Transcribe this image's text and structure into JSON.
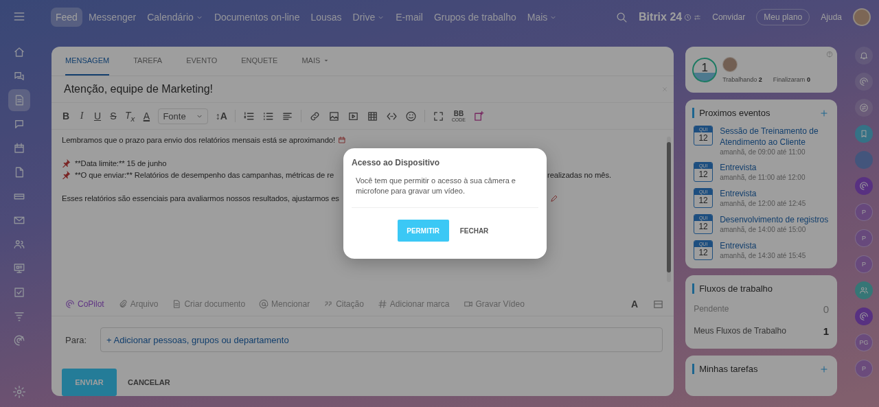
{
  "sidebar": {
    "items": [
      {
        "selected": false
      },
      {
        "selected": false
      },
      {
        "selected": true
      },
      {
        "selected": false
      },
      {
        "selected": false
      },
      {
        "selected": false
      },
      {
        "selected": false
      },
      {
        "selected": false
      },
      {
        "selected": false
      },
      {
        "selected": false
      },
      {
        "selected": false
      },
      {
        "selected": false
      },
      {
        "selected": false
      }
    ]
  },
  "topbar": {
    "nav": [
      {
        "label": "Feed",
        "selected": true,
        "dropdown": false
      },
      {
        "label": "Messenger",
        "selected": false,
        "dropdown": false
      },
      {
        "label": "Calendário",
        "selected": false,
        "dropdown": true
      },
      {
        "label": "Documentos on-line",
        "selected": false,
        "dropdown": false
      },
      {
        "label": "Lousas",
        "selected": false,
        "dropdown": false
      },
      {
        "label": "Drive",
        "selected": false,
        "dropdown": true
      },
      {
        "label": "E-mail",
        "selected": false,
        "dropdown": false
      },
      {
        "label": "Grupos de trabalho",
        "selected": false,
        "dropdown": false
      },
      {
        "label": "Mais",
        "selected": false,
        "dropdown": true
      }
    ],
    "logo": {
      "name": "Bitrix",
      "number": "24"
    },
    "invite": "Convidar",
    "plan": "Meu plano",
    "help": "Ajuda"
  },
  "editor": {
    "tabs": [
      {
        "label": "MENSAGEM",
        "selected": true,
        "dropdown": false
      },
      {
        "label": "TAREFA",
        "selected": false,
        "dropdown": false
      },
      {
        "label": "EVENTO",
        "selected": false,
        "dropdown": false
      },
      {
        "label": "ENQUETE",
        "selected": false,
        "dropdown": false
      },
      {
        "label": "MAIS",
        "selected": false,
        "dropdown": true
      }
    ],
    "title": "Atenção, equipe de Marketing!",
    "format": [
      {
        "kind": "bold",
        "text": "B"
      },
      {
        "kind": "italic",
        "text": "I"
      },
      {
        "kind": "underline",
        "text": "U"
      },
      {
        "kind": "strike",
        "text": "S"
      },
      {
        "kind": "clear",
        "text": "T$_{x}$"
      },
      {
        "kind": "color",
        "text": "A"
      }
    ],
    "font": "Fonte",
    "size": "↕A",
    "bbcode": [
      "BB",
      "CODE"
    ],
    "lines": [
      {
        "kind": "text",
        "text": "Lembramos que o prazo para envio dos relatórios mensais está se aproximando!",
        "emoji": true
      },
      {
        "kind": "blank"
      },
      {
        "kind": "pin",
        "text": "**Data limite:** 15 de junho"
      },
      {
        "kind": "pin",
        "text": "**O que enviar:** Relatórios de desempenho das campanhas, métricas de re",
        "tail": "realizadas no mês."
      },
      {
        "kind": "blank"
      },
      {
        "kind": "text",
        "text": "Esses relatórios são essenciais para avaliarmos nossos resultados, ajustarmos es",
        "tail_emoji": true
      }
    ],
    "actions": [
      {
        "kind": "copilot",
        "label": "CoPilot"
      },
      {
        "kind": "file",
        "label": "Arquivo"
      },
      {
        "kind": "doc",
        "label": "Criar documento"
      },
      {
        "kind": "mention",
        "label": "Mencionar"
      },
      {
        "kind": "quote",
        "label": "Citação"
      },
      {
        "kind": "tag",
        "label": "Adicionar marca"
      },
      {
        "kind": "video",
        "label": "Gravar Vídeo"
      }
    ],
    "text_style": "A",
    "to_label": "Para:",
    "to_add": "+ Adicionar pessoas, grupos ou departamento",
    "send": "ENVIAR",
    "cancel": "CANCELAR"
  },
  "status": {
    "count": "1",
    "working_label": "Trabalhando",
    "working": "2",
    "done_label": "Finalizaram",
    "done": "0"
  },
  "events": {
    "title": "Proximos eventos",
    "items": [
      {
        "day": "QUI",
        "date": "12",
        "title": "Sessão de Treinamento de Atendimento ao Cliente",
        "time": "amanhã, de 09:00 até 11:00"
      },
      {
        "day": "QUI",
        "date": "12",
        "title": "Entrevista",
        "time": "amanhã, de 11:00 até 12:00"
      },
      {
        "day": "QUI",
        "date": "12",
        "title": "Entrevista",
        "time": "amanhã, de 12:00 até 12:45"
      },
      {
        "day": "QUI",
        "date": "12",
        "title": "Desenvolvimento de registros",
        "time": "amanhã, de 14:00 até 15:00"
      },
      {
        "day": "QUI",
        "date": "12",
        "title": "Entrevista",
        "time": "amanhã, de 14:30 até 15:45"
      }
    ]
  },
  "workflows": {
    "title": "Fluxos de trabalho",
    "rows": [
      {
        "label": "Pendente",
        "value": "0",
        "muted": true
      },
      {
        "label": "Meus Fluxos de Trabalho",
        "value": "1",
        "muted": false
      }
    ]
  },
  "tasks": {
    "title": "Minhas tarefas"
  },
  "rail": [
    {
      "kind": "bell"
    },
    {
      "kind": "spiral"
    },
    {
      "kind": "swap"
    },
    {
      "kind": "bookmark"
    },
    {
      "kind": "avatar"
    },
    {
      "kind": "copilot"
    },
    {
      "kind": "initials",
      "text": "P"
    },
    {
      "kind": "initials",
      "text": "P"
    },
    {
      "kind": "initials",
      "text": "P"
    },
    {
      "kind": "group"
    },
    {
      "kind": "copilot"
    },
    {
      "kind": "initials",
      "text": "PG"
    },
    {
      "kind": "initials",
      "text": "P"
    }
  ],
  "dialog": {
    "title": "Acesso ao Dispositivo",
    "message": "Você tem que permitir o acesso à sua câmera e microfone para gravar um vídeo.",
    "confirm": "PERMITIR",
    "close": "FECHAR"
  }
}
